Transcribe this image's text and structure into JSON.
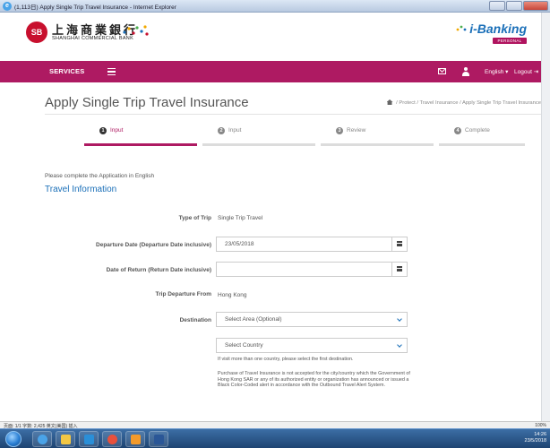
{
  "window": {
    "title": "(1,113日) Apply Single Trip Travel Insurance - Internet Explorer"
  },
  "header": {
    "bank_name_cn": "上海商業銀行",
    "bank_name_en": "SHANGHAI COMMERCIAL BANK",
    "ibanking_logo": "i-Banking",
    "ibanking_badge": "PERSONAL"
  },
  "nav": {
    "services": "SERVICES",
    "language": "English ▾",
    "logout": "Logout"
  },
  "page": {
    "title": "Apply Single Trip Travel Insurance",
    "breadcrumb": [
      "Protect",
      "Travel Insurance",
      "Apply Single Trip Travel Insurance"
    ]
  },
  "steps": [
    {
      "num": "1",
      "label": "Input",
      "active": true
    },
    {
      "num": "2",
      "label": "Input",
      "active": false
    },
    {
      "num": "3",
      "label": "Review",
      "active": false
    },
    {
      "num": "4",
      "label": "Complete",
      "active": false
    }
  ],
  "form": {
    "intro": "Please complete the Application in English",
    "section_title": "Travel Information",
    "type_of_trip_label": "Type of Trip",
    "type_of_trip_value": "Single Trip Travel",
    "departure_label": "Departure Date (Departure Date inclusive)",
    "departure_value": "23/05/2018",
    "return_label": "Date of Return (Return Date inclusive)",
    "return_value": "",
    "trip_departure_label": "Trip Departure From",
    "trip_departure_value": "Hong Kong",
    "destination_label": "Destination",
    "area_select": "Select Area (Optional)",
    "country_select": "Select Country",
    "hint": "If visit more than one country, please select the first destination.",
    "notice": "Purchase of Travel Insurance is not accepted for the city/country which the Government of Hong Kong SAR or any of its authorized entity or organization has announced or issued a Black Color-Coded alert in accordance with the Outbound Travel Alert System."
  },
  "statusbar": {
    "left": "页面: 1/1  字数: 2,425  英文(美国)  插入",
    "zoom": "100%"
  },
  "taskbar": {
    "time": "14:26",
    "date": "23/5/2018"
  },
  "colors": {
    "brand_magenta": "#ae1a62",
    "link_blue": "#1a6fb8",
    "logo_red": "#c8102e"
  }
}
